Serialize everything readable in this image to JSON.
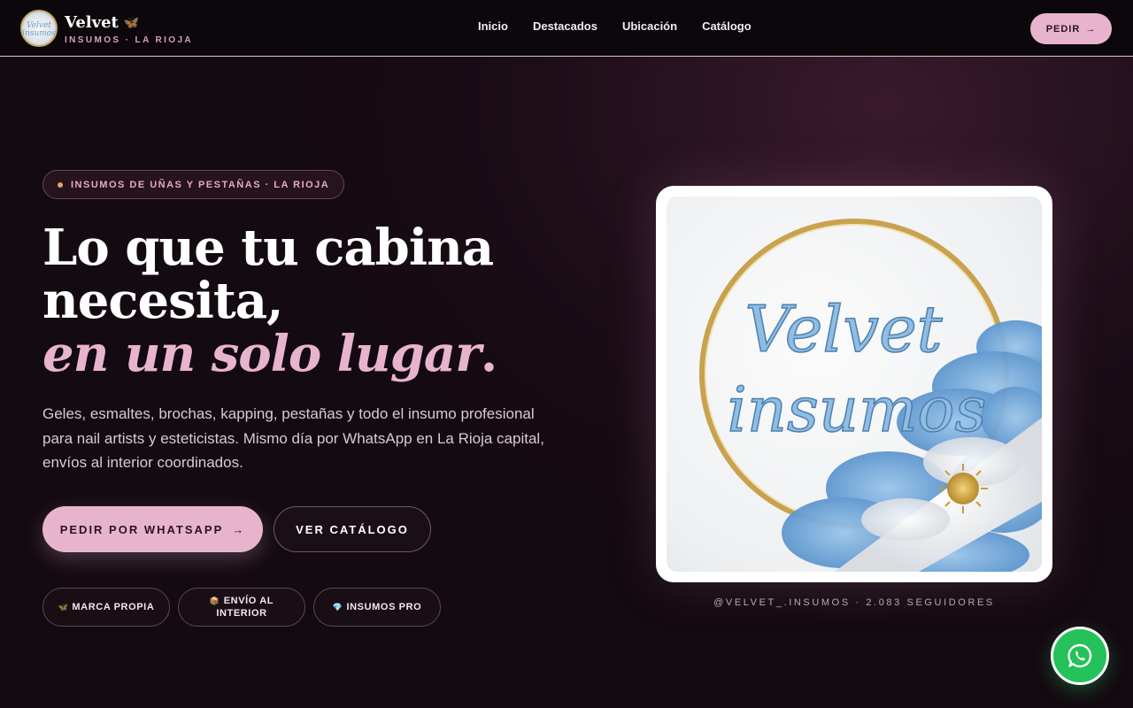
{
  "header": {
    "brand_name": "Velvet",
    "brand_emoji": "🦋",
    "brand_sub": "INSUMOS · LA RIOJA",
    "logo_text": "Velvet insumos",
    "nav": [
      "Inicio",
      "Destacados",
      "Ubicación",
      "Catálogo"
    ],
    "cta_label": "PEDIR",
    "cta_arrow": "→"
  },
  "hero": {
    "tag": "INSUMOS DE UÑAS Y PESTAÑAS · LA RIOJA",
    "headline_line1": "Lo que tu cabina",
    "headline_line2": "necesita,",
    "headline_accent": "en un solo lugar",
    "headline_dot": ".",
    "lead": "Geles, esmaltes, brochas, kapping, pestañas y todo el insumo profesional para nail artists y esteticistas. Mismo día por WhatsApp en La Rioja capital, envíos al interior coordinados.",
    "primary_button": "PEDIR POR WHATSAPP",
    "primary_arrow": "→",
    "secondary_button": "VER CATÁLOGO",
    "chips": [
      {
        "icon": "🦋",
        "label": "MARCA PROPIA"
      },
      {
        "icon": "📦",
        "label": "ENVÍO AL INTERIOR"
      },
      {
        "icon": "💎",
        "label": "INSUMOS PRO"
      }
    ]
  },
  "card": {
    "image_text_line1": "Velvet",
    "image_text_line2": "insumos",
    "caption": "@VELVET_.INSUMOS · 2.083 SEGUIDORES"
  },
  "colors": {
    "accent_pink": "#e8b4cd",
    "whatsapp_green": "#25c15a",
    "gold": "#c9a24e",
    "sky_blue": "#74a9d8"
  },
  "icons": {
    "whatsapp": "whatsapp-icon",
    "arrow": "arrow-right-icon"
  }
}
